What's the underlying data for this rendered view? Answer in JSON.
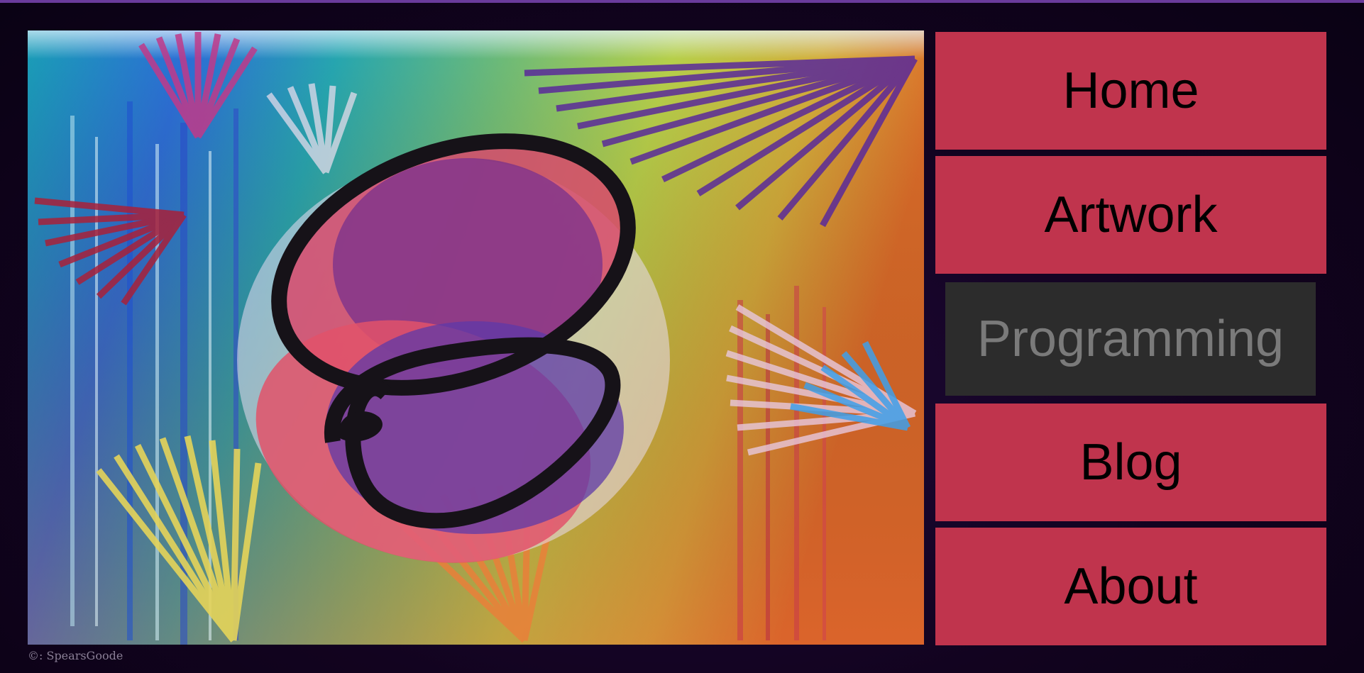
{
  "colors": {
    "background": "#12031f",
    "accent_bar": "#6a3b9c",
    "nav_button": "#c0344d",
    "nav_button_active": "#2c2c2c",
    "nav_text": "#000000",
    "nav_text_active": "#7a7a7a"
  },
  "nav": {
    "items": [
      {
        "label": "Home",
        "active": false
      },
      {
        "label": "Artwork",
        "active": false
      },
      {
        "label": "Programming",
        "active": true
      },
      {
        "label": "Blog",
        "active": false
      },
      {
        "label": "About",
        "active": false
      }
    ]
  },
  "hero": {
    "description": "abstract-painting-logo"
  },
  "footer": {
    "credit": "©: SpearsGoode"
  }
}
